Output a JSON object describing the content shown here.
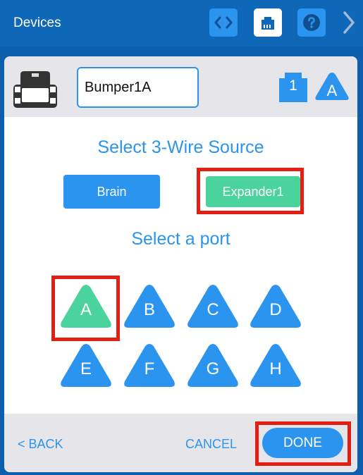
{
  "header": {
    "title": "Devices",
    "icons": [
      "code-brackets-icon",
      "port-icon",
      "help-icon",
      "chevron-right-icon"
    ]
  },
  "device": {
    "icon": "bumper-sensor-icon",
    "name_value": "Bumper1A",
    "port_number": "1",
    "port_letter": "A"
  },
  "source": {
    "title": "Select 3-Wire Source",
    "options": [
      "Brain",
      "Expander1"
    ],
    "selected": "Expander1"
  },
  "ports": {
    "title": "Select a port",
    "items": [
      "A",
      "B",
      "C",
      "D",
      "E",
      "F",
      "G",
      "H"
    ],
    "selected": "A"
  },
  "footer": {
    "back": "< BACK",
    "cancel": "CANCEL",
    "done": "DONE"
  },
  "colors": {
    "blue": "#2b94ef",
    "header": "#0f67b8",
    "selected_green": "#4bd39d",
    "highlight_red": "#e31f13",
    "panel_gray": "#e6e6ea"
  }
}
